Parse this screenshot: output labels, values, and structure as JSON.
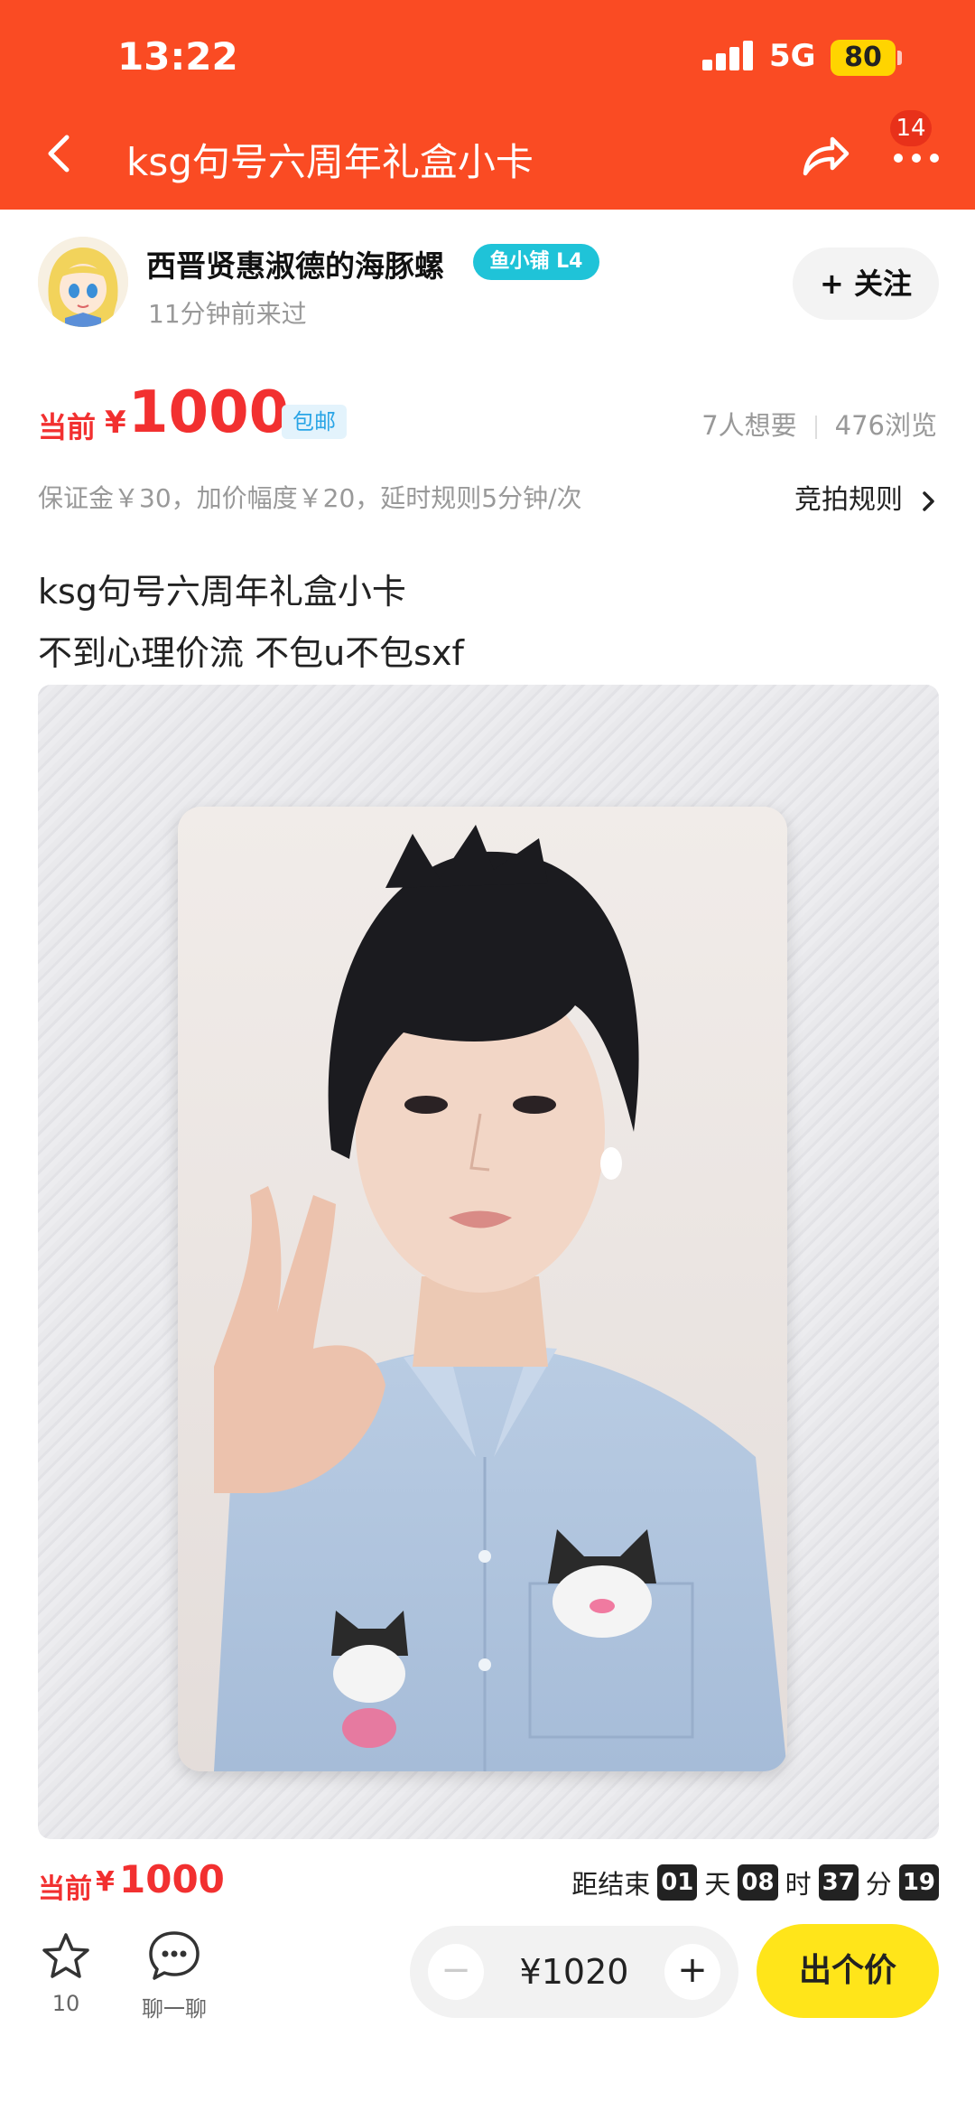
{
  "status_bar": {
    "time": "13:22",
    "network": "5G",
    "battery": "80"
  },
  "nav": {
    "title": "ksg句号六周年礼盒小卡",
    "message_badge": "14"
  },
  "seller": {
    "name": "西晋贤惠淑德的海豚螺",
    "shop_badge": "鱼小铺 L4",
    "last_seen": "11分钟前来过",
    "follow_label": "+ 关注"
  },
  "price": {
    "label": "当前",
    "symbol": "¥",
    "value": "1000",
    "shipping_tag": "包邮",
    "wants": "7人想要",
    "views": "476浏览"
  },
  "auction": {
    "rules_text": "保证金￥30，加价幅度￥20，延时规则5分钟/次",
    "rules_link": "竞拍规则"
  },
  "description": {
    "title": "ksg句号六周年礼盒小卡",
    "note": "不到心理价流 不包u不包sxf"
  },
  "bottom": {
    "price_label": "当前",
    "price_symbol": "¥",
    "price_value": "1000",
    "countdown_prefix": "距结束",
    "days": "01",
    "days_unit": "天",
    "hours": "08",
    "hours_unit": "时",
    "minutes": "37",
    "minutes_unit": "分",
    "seconds": "19",
    "favorite_count": "10",
    "chat_label": "聊一聊",
    "bid_value": "¥1020",
    "minus": "−",
    "plus": "+",
    "bid_button": "出个价"
  },
  "colors": {
    "brand": "#FA4B23",
    "price": "#F23030",
    "cta": "#FFE51A",
    "badge": "#1FC3D8"
  },
  "icons": [
    "back-arrow-icon",
    "share-icon",
    "more-icon",
    "star-icon",
    "chat-bubble-icon"
  ]
}
